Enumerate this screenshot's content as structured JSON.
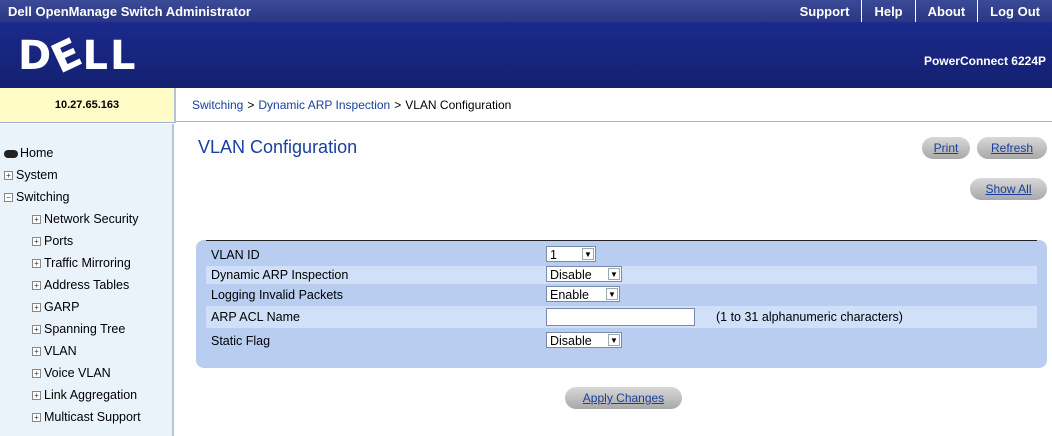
{
  "header": {
    "app_title": "Dell OpenManage Switch Administrator",
    "links": [
      "Support",
      "Help",
      "About",
      "Log Out"
    ],
    "logo": "DÉLL",
    "model": "PowerConnect 6224P"
  },
  "device": {
    "ip": "10.27.65.163"
  },
  "breadcrumb": {
    "items": [
      "Switching",
      "Dynamic ARP Inspection"
    ],
    "current": "VLAN Configuration",
    "separator": ">"
  },
  "sidebar": {
    "home": "Home",
    "items": [
      {
        "label": "System",
        "toggle": "+"
      },
      {
        "label": "Switching",
        "toggle": "−"
      },
      {
        "label": "Network Security",
        "toggle": "+"
      },
      {
        "label": "Ports",
        "toggle": "+"
      },
      {
        "label": "Traffic Mirroring",
        "toggle": "+"
      },
      {
        "label": "Address Tables",
        "toggle": "+"
      },
      {
        "label": "GARP",
        "toggle": "+"
      },
      {
        "label": "Spanning Tree",
        "toggle": "+"
      },
      {
        "label": "VLAN",
        "toggle": "+"
      },
      {
        "label": "Voice VLAN",
        "toggle": "+"
      },
      {
        "label": "Link Aggregation",
        "toggle": "+"
      },
      {
        "label": "Multicast Support",
        "toggle": "+"
      }
    ]
  },
  "main": {
    "title": "VLAN Configuration",
    "buttons": {
      "print": "Print",
      "refresh": "Refresh",
      "show_all": "Show All",
      "apply": "Apply Changes"
    },
    "form": {
      "vlan_id": {
        "label": "VLAN ID",
        "value": "1"
      },
      "dai": {
        "label": "Dynamic ARP Inspection",
        "value": "Disable"
      },
      "logging": {
        "label": "Logging Invalid Packets",
        "value": "Enable"
      },
      "acl_name": {
        "label": "ARP ACL Name",
        "value": "",
        "hint": "(1 to 31 alphanumeric characters)"
      },
      "static_flag": {
        "label": "Static Flag",
        "value": "Disable"
      }
    }
  },
  "colors": {
    "topbar": "#2a3780",
    "brandbar": "#1b2a8c",
    "link": "#1a3fa0",
    "panel": "#b8cdef",
    "sidebar": "#eaf2fa"
  }
}
